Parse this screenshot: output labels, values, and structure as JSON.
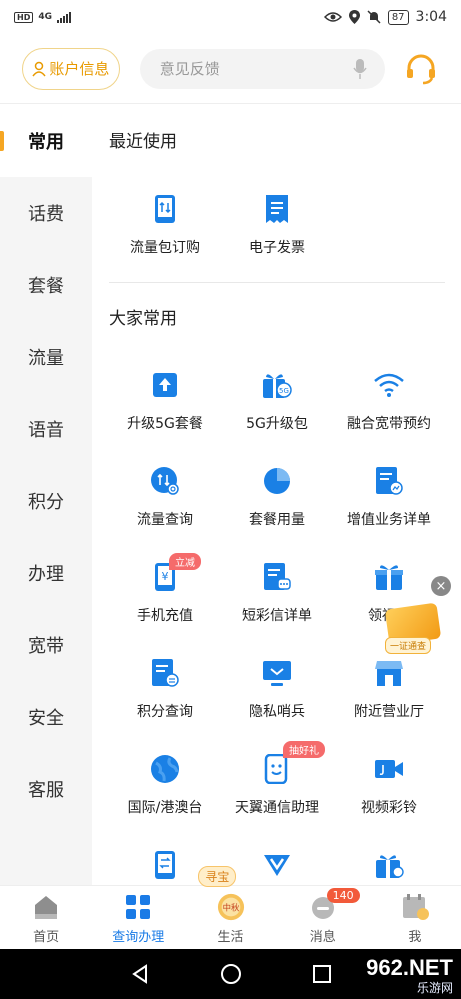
{
  "status_bar": {
    "network": "4G",
    "speed": "",
    "battery": "87",
    "time": "3:04"
  },
  "header": {
    "account_label": "账户信息",
    "search_placeholder": "意见反馈"
  },
  "sidebar": {
    "items": [
      {
        "label": "常用"
      },
      {
        "label": "话费"
      },
      {
        "label": "套餐"
      },
      {
        "label": "流量"
      },
      {
        "label": "语音"
      },
      {
        "label": "积分"
      },
      {
        "label": "办理"
      },
      {
        "label": "宽带"
      },
      {
        "label": "安全"
      },
      {
        "label": "客服"
      }
    ]
  },
  "main": {
    "recent_title": "最近使用",
    "recent": [
      {
        "label": "流量包订购",
        "icon": "phone-data-icon"
      },
      {
        "label": "电子发票",
        "icon": "receipt-icon"
      }
    ],
    "common_title": "大家常用",
    "common": [
      {
        "label": "升级5G套餐",
        "icon": "upgrade-icon"
      },
      {
        "label": "5G升级包",
        "icon": "gift-5g-icon"
      },
      {
        "label": "融合宽带预约",
        "icon": "wifi-icon"
      },
      {
        "label": "流量查询",
        "icon": "data-query-icon"
      },
      {
        "label": "套餐用量",
        "icon": "pie-chart-icon"
      },
      {
        "label": "增值业务详单",
        "icon": "doc-chart-icon"
      },
      {
        "label": "手机充值",
        "icon": "phone-yuan-icon",
        "tag": "立减"
      },
      {
        "label": "短彩信详单",
        "icon": "sms-doc-icon"
      },
      {
        "label": "领福利",
        "icon": "gift-icon"
      },
      {
        "label": "积分查询",
        "icon": "points-doc-icon"
      },
      {
        "label": "隐私哨兵",
        "icon": "monitor-icon"
      },
      {
        "label": "附近营业厅",
        "icon": "store-icon"
      },
      {
        "label": "国际/港澳台",
        "icon": "globe-icon"
      },
      {
        "label": "天翼通信助理",
        "icon": "assistant-icon",
        "tag": "抽好礼"
      },
      {
        "label": "视频彩铃",
        "icon": "video-icon"
      },
      {
        "label": "",
        "icon": "phone-swap-icon"
      },
      {
        "label": "",
        "icon": "vip-icon"
      },
      {
        "label": "",
        "icon": "gift-yuan-icon"
      }
    ]
  },
  "floating_ad": {
    "chip_label": "一证通查"
  },
  "tabbar": {
    "items": [
      {
        "label": "首页"
      },
      {
        "label": "查询办理"
      },
      {
        "label": "生活"
      },
      {
        "label": "消息"
      },
      {
        "label": "我"
      }
    ],
    "message_badge": "140",
    "hunt_label": "寻宝",
    "life_icon_text": "中秋"
  },
  "watermark": {
    "text": "962.NET",
    "sub": "乐游网"
  },
  "colors": {
    "accent": "#1a7be6",
    "gold": "#e89a00",
    "icon_blue": "#1a80e5"
  }
}
